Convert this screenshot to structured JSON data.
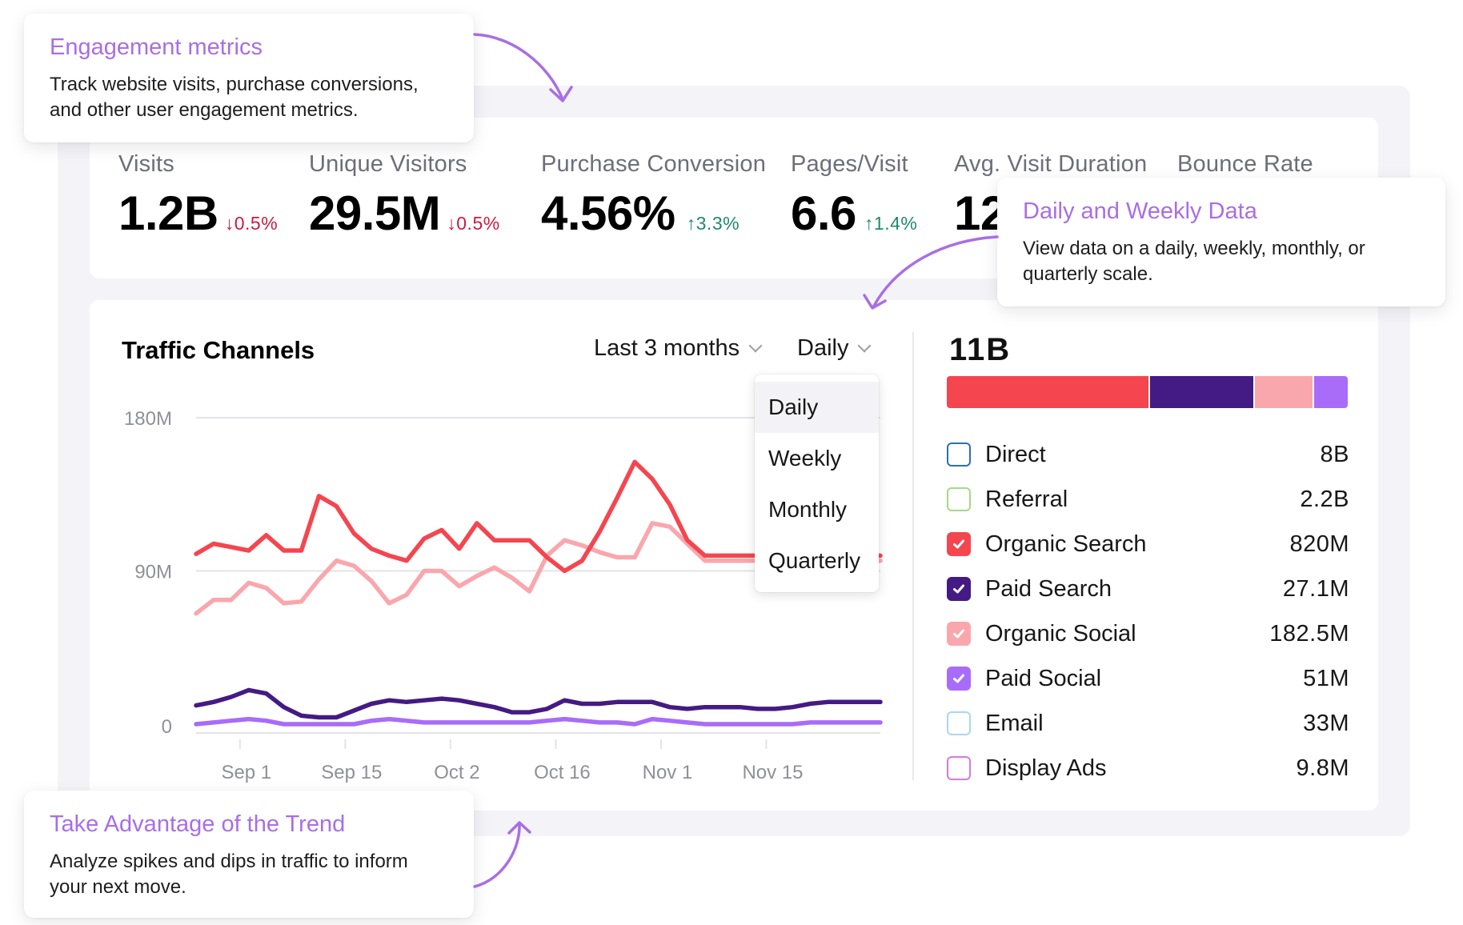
{
  "callouts": {
    "engagement": {
      "title": "Engagement metrics",
      "text": "Track website visits, purchase conversions, and other user engagement metrics."
    },
    "daily_weekly": {
      "title": "Daily and Weekly Data",
      "text": "View data on a daily, weekly, monthly, or quarterly scale."
    },
    "trend": {
      "title": "Take Advantage of the Trend",
      "text": "Analyze spikes and dips in traffic to inform your next move."
    }
  },
  "metrics": [
    {
      "label": "Visits",
      "value": "1.2B",
      "delta": "↓0.5%",
      "direction": "down"
    },
    {
      "label": "Unique Visitors",
      "value": "29.5M",
      "delta": "↓0.5%",
      "direction": "down"
    },
    {
      "label": "Purchase Conversion",
      "value": "4.56%",
      "delta": "↑3.3%",
      "direction": "up"
    },
    {
      "label": "Pages/Visit",
      "value": "6.6",
      "delta": "↑1.4%",
      "direction": "up"
    },
    {
      "label": "Avg. Visit Duration",
      "value": "12",
      "delta": "",
      "direction": ""
    },
    {
      "label": "Bounce Rate",
      "value": "",
      "delta": "",
      "direction": ""
    }
  ],
  "traffic": {
    "title": "Traffic Channels",
    "range_select": "Last 3 months",
    "granularity_select": "Daily",
    "granularity_options": [
      "Daily",
      "Weekly",
      "Monthly",
      "Quarterly"
    ],
    "active_option": "Daily",
    "total": "11B",
    "stack_bar": [
      {
        "channel": "Organic Search",
        "share": 0.51,
        "color": "#f5454f"
      },
      {
        "channel": "Paid Search",
        "share": 0.26,
        "color": "#441a84"
      },
      {
        "channel": "Organic Social",
        "share": 0.145,
        "color": "#f9a7ad"
      },
      {
        "channel": "Paid Social",
        "share": 0.085,
        "color": "#a86cf9"
      }
    ],
    "channels": [
      {
        "label": "Direct",
        "value": "8B",
        "checked": false,
        "color": "#2e6fb3"
      },
      {
        "label": "Referral",
        "value": "2.2B",
        "checked": false,
        "color": "#a8d884"
      },
      {
        "label": "Organic Search",
        "value": "820M",
        "checked": true,
        "color": "#f5454f"
      },
      {
        "label": "Paid Search",
        "value": "27.1M",
        "checked": true,
        "color": "#441a84"
      },
      {
        "label": "Organic Social",
        "value": "182.5M",
        "checked": true,
        "color": "#f9a7ad"
      },
      {
        "label": "Paid Social",
        "value": "51M",
        "checked": true,
        "color": "#a86cf9"
      },
      {
        "label": "Email",
        "value": "33M",
        "checked": false,
        "color": "#a9d8ee"
      },
      {
        "label": "Display Ads",
        "value": "9.8M",
        "checked": false,
        "color": "#d579e0"
      }
    ]
  },
  "chart_data": {
    "type": "line",
    "title": "Traffic Channels",
    "xlabel": "",
    "ylabel": "",
    "ylim": [
      0,
      180
    ],
    "y_unit": "M",
    "y_ticks": [
      "0",
      "90M",
      "180M"
    ],
    "x_ticks": [
      "Sep 1",
      "Sep 15",
      "Oct 2",
      "Oct 16",
      "Nov 1",
      "Nov 15"
    ],
    "x_tick_index": [
      2.5,
      8.5,
      14.5,
      20.5,
      26.5,
      32.5
    ],
    "n_points": 40,
    "grid": true,
    "series": [
      {
        "name": "Organic Search",
        "color": "#f5454f",
        "values": [
          100,
          106,
          104,
          102,
          111,
          102,
          102,
          134,
          128,
          112,
          103,
          99,
          96,
          109,
          114,
          103,
          118,
          108,
          108,
          108,
          98,
          90,
          96,
          113,
          133,
          154,
          144,
          129,
          108,
          99,
          99,
          99,
          99,
          99,
          99,
          99,
          99,
          99,
          99,
          99
        ]
      },
      {
        "name": "Organic Social",
        "color": "#f9a7ad",
        "values": [
          65,
          73,
          73,
          83,
          80,
          71,
          72,
          85,
          96,
          93,
          84,
          71,
          76,
          90,
          90,
          81,
          87,
          92,
          86,
          78,
          99,
          108,
          105,
          101,
          98,
          98,
          118,
          116,
          106,
          96,
          96,
          96,
          96,
          96,
          96,
          96,
          96,
          96,
          96,
          96
        ]
      },
      {
        "name": "Paid Search",
        "color": "#441a84",
        "values": [
          11,
          13,
          16,
          20,
          18,
          10,
          5,
          4,
          4,
          8,
          12,
          14,
          13,
          14,
          15,
          14,
          12,
          10,
          7,
          7,
          9,
          14,
          12,
          12,
          13,
          13,
          13,
          10,
          9,
          10,
          10,
          10,
          9,
          9,
          10,
          12,
          13,
          13,
          13,
          13
        ]
      },
      {
        "name": "Paid Social",
        "color": "#a86cf9",
        "values": [
          0,
          1,
          2,
          3,
          2,
          0,
          0,
          0,
          0,
          0,
          2,
          3,
          2,
          1,
          1,
          1,
          1,
          1,
          1,
          1,
          2,
          3,
          2,
          1,
          1,
          0,
          3,
          2,
          1,
          0,
          0,
          0,
          0,
          0,
          0,
          1,
          1,
          1,
          1,
          1
        ]
      }
    ]
  }
}
